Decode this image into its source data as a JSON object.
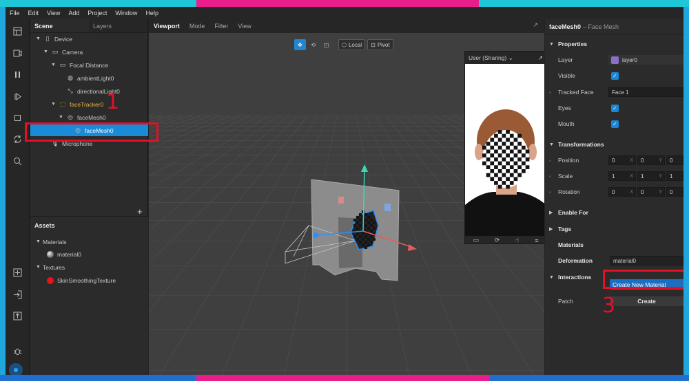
{
  "menu": [
    "File",
    "Edit",
    "View",
    "Add",
    "Project",
    "Window",
    "Help"
  ],
  "scene_panel": {
    "tabs": [
      "Scene",
      "Layers"
    ],
    "tree": [
      {
        "label": "Device",
        "icon": "device-icon",
        "indent": 1,
        "twisty": "▼"
      },
      {
        "label": "Camera",
        "icon": "camera-icon",
        "indent": 2,
        "twisty": "▼"
      },
      {
        "label": "Focal Distance",
        "icon": "focal-distance-icon",
        "indent": 3,
        "twisty": "▼"
      },
      {
        "label": "ambientLight0",
        "icon": "ambient-light-icon",
        "indent": 4,
        "twisty": ""
      },
      {
        "label": "directionalLight0",
        "icon": "directional-light-icon",
        "indent": 4,
        "twisty": ""
      },
      {
        "label": "faceTracker0",
        "icon": "face-tracker-icon",
        "indent": 3,
        "twisty": "▼"
      },
      {
        "label": "faceMesh0",
        "icon": "face-mesh-icon",
        "indent": 4,
        "twisty": "▼"
      },
      {
        "label": "faceMesh0",
        "icon": "face-mesh-icon",
        "indent": 5,
        "twisty": ""
      },
      {
        "label": "Microphone",
        "icon": "microphone-icon",
        "indent": 2,
        "twisty": ""
      }
    ],
    "add_button": "+",
    "assets": {
      "title": "Assets",
      "groups": [
        {
          "label": "Materials",
          "items": [
            {
              "label": "material0",
              "icon": "material-sphere-icon"
            }
          ]
        },
        {
          "label": "Textures",
          "items": [
            {
              "label": "SkinSmoothingTexture",
              "icon": "texture-icon"
            }
          ]
        }
      ]
    }
  },
  "viewport": {
    "tabs": [
      "Viewport",
      "Mode",
      "Filter",
      "View"
    ],
    "tools": [
      "Local",
      "Pivot"
    ],
    "simulator": {
      "device_label": "User (Sharing)"
    }
  },
  "properties": {
    "object_name": "faceMesh0",
    "object_type": "– Face Mesh",
    "sections": {
      "properties": "Properties",
      "transformations": "Transformations",
      "enable_for": "Enable For",
      "tags": "Tags",
      "interactions": "Interactions"
    },
    "layer": {
      "label": "Layer",
      "value": "layer0"
    },
    "visible": {
      "label": "Visible",
      "checked": true
    },
    "tracked_face": {
      "label": "Tracked Face",
      "value": "Face 1"
    },
    "eyes": {
      "label": "Eyes",
      "checked": true
    },
    "mouth": {
      "label": "Mouth",
      "checked": true
    },
    "position": {
      "label": "Position",
      "values": [
        "0",
        "0",
        "0"
      ]
    },
    "scale": {
      "label": "Scale",
      "values": [
        "1",
        "1",
        "1"
      ]
    },
    "rotation": {
      "label": "Rotation",
      "values": [
        "0",
        "0",
        "0"
      ]
    },
    "axes": [
      "X",
      "Y"
    ],
    "materials_label": "Materials",
    "deformation": {
      "label": "Deformation",
      "value": "material0"
    },
    "dropdown_option": "Create New Material",
    "patch": {
      "label": "Patch",
      "button": "Create"
    }
  },
  "annotations": [
    "1",
    "3"
  ],
  "colors": {
    "highlight": "#e3102a",
    "accent": "#1a86d8",
    "frame_pink": "#e91e8c",
    "frame_cyan": "#1fc7d6",
    "frame_blue": "#1f6fd1"
  }
}
